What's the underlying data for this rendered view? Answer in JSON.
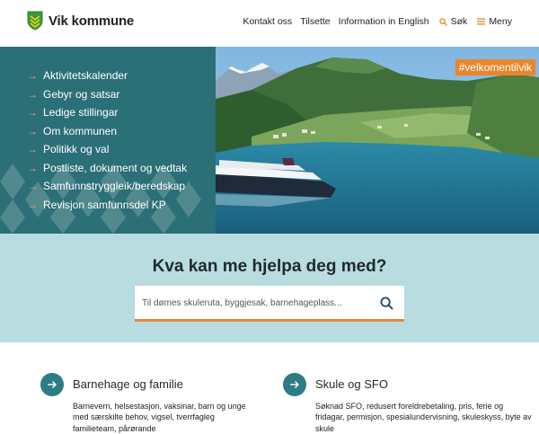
{
  "header": {
    "logo_text": "Vik kommune",
    "nav": {
      "contact": "Kontakt oss",
      "tilsette": "Tilsette",
      "english": "Information in English",
      "search": "Søk",
      "menu": "Meny"
    }
  },
  "hero": {
    "menu_items": [
      "Aktivitetskalender",
      "Gebyr og satsar",
      "Ledige stillingar",
      "Om kommunen",
      "Politikk og val",
      "Postliste, dokument og vedtak",
      "Samfunnstryggleik/beredskap",
      "Revisjon samfunnsdel KP"
    ],
    "hashtag": "#velkomentilvik"
  },
  "search": {
    "title": "Kva kan me hjelpa deg med?",
    "placeholder": "Til dømes skuleruta, byggjesak, barnehageplass..."
  },
  "categories": [
    {
      "title": "Barnehage og familie",
      "description": "Barnevern, helsestasjon, vaksinar, barn og unge med særskilte behov, vigsel, tverrfagleg familieteam, pårørande"
    },
    {
      "title": "Skule og SFO",
      "description": "Søknad SFO, redusert foreldrebetaling, pris, ferie og fridagar, permisjon, spesialundervisning, skuleskyss, byte av skule"
    }
  ],
  "colors": {
    "brand_teal": "#2b6f77",
    "accent_orange": "#e9862c",
    "search_band": "#b8dce0",
    "logo_green": "#3a9a3a"
  }
}
